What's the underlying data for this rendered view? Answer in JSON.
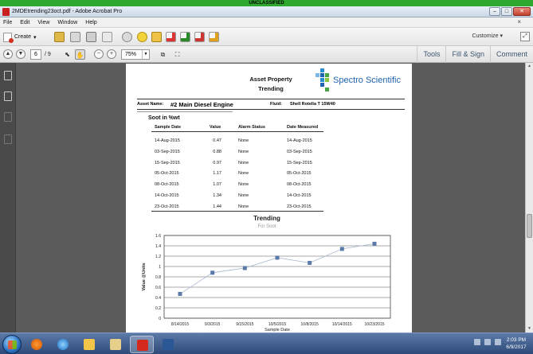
{
  "classification": "UNCLASSIFIED",
  "window": {
    "title": "2MDEtrending23oct.pdf - Adobe Acrobat Pro",
    "min": "–",
    "max": "□",
    "close": "✕"
  },
  "menu": [
    "File",
    "Edit",
    "View",
    "Window",
    "Help"
  ],
  "menu_close": "×",
  "toolbar": {
    "create_label": "Create",
    "customize_label": "Customize",
    "expand": "⤢"
  },
  "nav": {
    "page_current": "6",
    "page_total": "/ 9",
    "zoom": "75%",
    "tools": "Tools",
    "fill_sign": "Fill & Sign",
    "comment": "Comment"
  },
  "report": {
    "title_line1": "Asset Property",
    "title_line2": "Trending",
    "logo_text": "Spectro Scientific",
    "asset_label": "Asset Name:",
    "asset_value": "#2 Main Diesel Engine",
    "fluid_label": "Fluid:",
    "fluid_value": "Shell Rotella T 15W40",
    "section_title": "Soot in %wt",
    "columns": [
      "Sample Date",
      "Value",
      "Alarm Status",
      "Date Measured"
    ],
    "rows": [
      [
        "14-Aug-2015",
        "0.47",
        "None",
        "14-Aug-2015"
      ],
      [
        "03-Sep-2015",
        "0.88",
        "None",
        "03-Sep-2015"
      ],
      [
        "15-Sep-2015",
        "0.97",
        "None",
        "15-Sep-2015"
      ],
      [
        "05-Oct-2015",
        "1.17",
        "None",
        "05-Oct-2015"
      ],
      [
        "08-Oct-2015",
        "1.07",
        "None",
        "08-Oct-2015"
      ],
      [
        "14-Oct-2015",
        "1.34",
        "None",
        "14-Oct-2015"
      ],
      [
        "23-Oct-2015",
        "1.44",
        "None",
        "23-Oct-2015"
      ]
    ]
  },
  "chart_data": {
    "type": "line",
    "title": "Trending",
    "subtitle": "For Soot",
    "xlabel": "Sample Date",
    "ylabel": "Value @Units",
    "categories": [
      "8/14/2015",
      "9/3/2015",
      "9/15/2015",
      "10/5/2015",
      "10/8/2015",
      "10/14/2015",
      "10/23/2015"
    ],
    "series": [
      {
        "values": [
          0.47,
          0.88,
          0.97,
          1.17,
          1.07,
          1.34,
          1.44
        ],
        "color": "#5b7aa8"
      }
    ],
    "yticks": [
      "0",
      "0.2",
      "0.4",
      "0.6",
      "0.8",
      "1",
      "1.2",
      "1.4",
      "1.6"
    ],
    "ylim": [
      0,
      1.6
    ],
    "grid": true
  },
  "taskbar": {
    "time": "2:03 PM",
    "date": "6/9/2017"
  }
}
